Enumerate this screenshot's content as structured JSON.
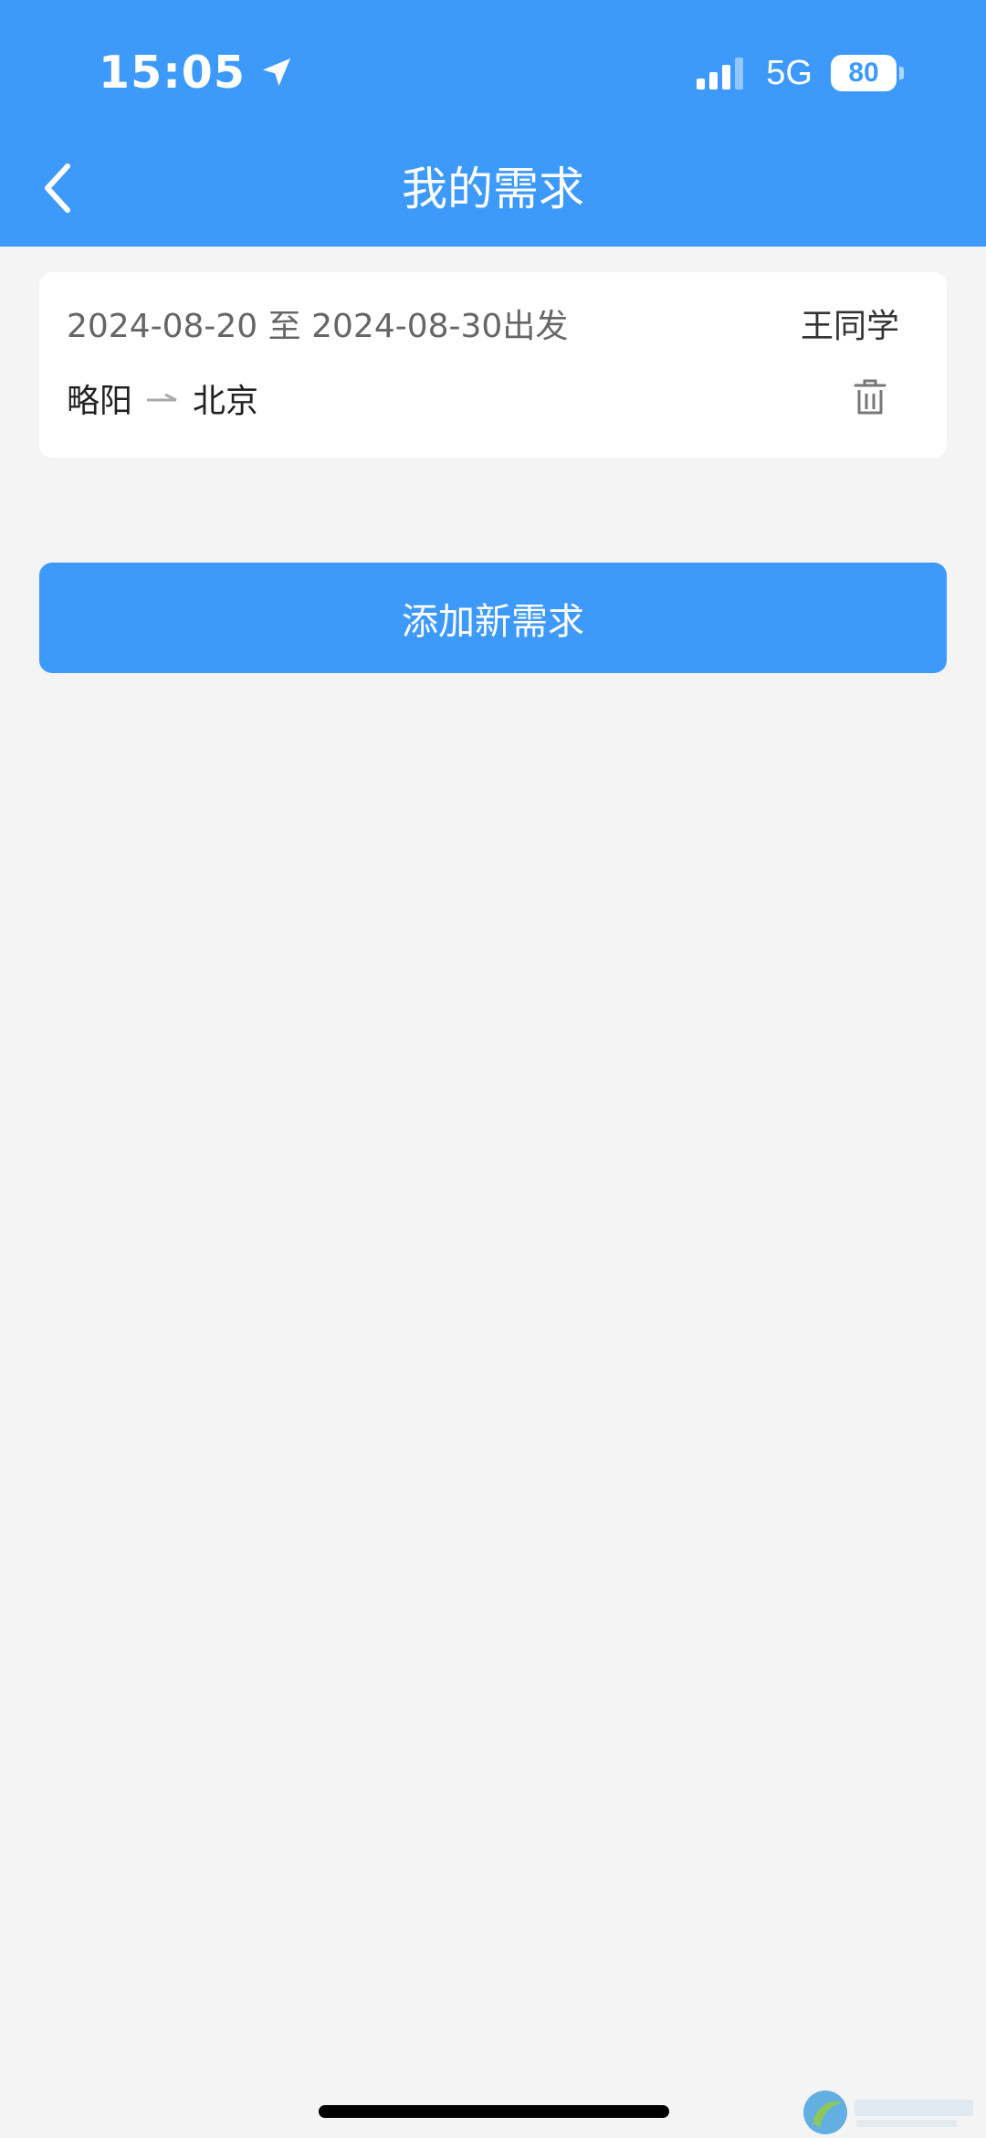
{
  "status_bar": {
    "time": "15:05",
    "network": "5G",
    "battery": "80"
  },
  "nav": {
    "title": "我的需求",
    "back_icon": "chevron-left-icon"
  },
  "demand_card": {
    "date_range": "2024-08-20 至 2024-08-30出发",
    "user": "王同学",
    "origin": "略阳",
    "destination": "北京",
    "delete_icon": "trash-icon"
  },
  "add_button_label": "添加新需求",
  "colors": {
    "primary": "#3d9afb",
    "background": "#f4f4f4",
    "card": "#ffffff"
  }
}
